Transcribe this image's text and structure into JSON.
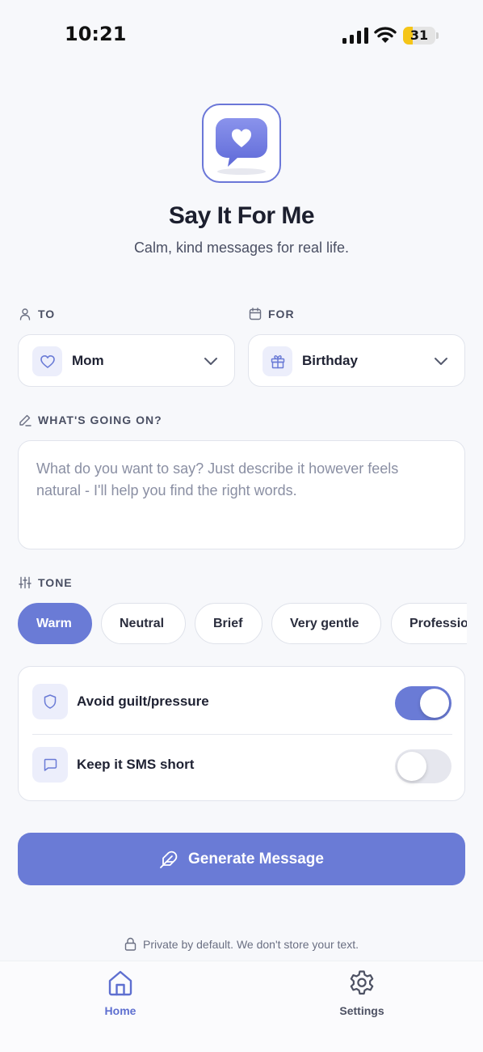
{
  "status_bar": {
    "time": "10:21",
    "battery": "31",
    "battery_level": 0.31
  },
  "header": {
    "title": "Say It For Me",
    "subtitle": "Calm, kind messages for real life.",
    "icon": "heart-chat-bubble-icon"
  },
  "to": {
    "label": "TO",
    "icon": "user-icon",
    "value": "Mom",
    "value_icon": "heart-icon"
  },
  "for": {
    "label": "FOR",
    "icon": "calendar-icon",
    "value": "Birthday",
    "value_icon": "gift-icon"
  },
  "context": {
    "label": "WHAT'S GOING ON?",
    "icon": "pencil-icon",
    "placeholder": "What do you want to say? Just describe it however feels natural - I'll help you find the right words.",
    "value": ""
  },
  "tone": {
    "label": "TONE",
    "icon": "sliders-icon",
    "options": [
      "Warm",
      "Neutral",
      "Brief",
      "Very gentle",
      "Professional"
    ],
    "selected": "Warm"
  },
  "options": [
    {
      "label": "Avoid guilt/pressure",
      "icon": "shield-icon",
      "enabled": true
    },
    {
      "label": "Keep it SMS short",
      "icon": "message-square-icon",
      "enabled": false
    }
  ],
  "generate": {
    "label": "Generate Message",
    "icon": "feather-icon"
  },
  "privacy": {
    "text": "Private by default. We don't store your text.",
    "icon": "lock-icon"
  },
  "tabs": [
    {
      "label": "Home",
      "icon": "home-icon",
      "active": true
    },
    {
      "label": "Settings",
      "icon": "gear-icon",
      "active": false
    }
  ],
  "colors": {
    "accent": "#6a7bd6",
    "background": "#f7f8fb",
    "text": "#1f2233",
    "muted": "#4a4f63"
  }
}
